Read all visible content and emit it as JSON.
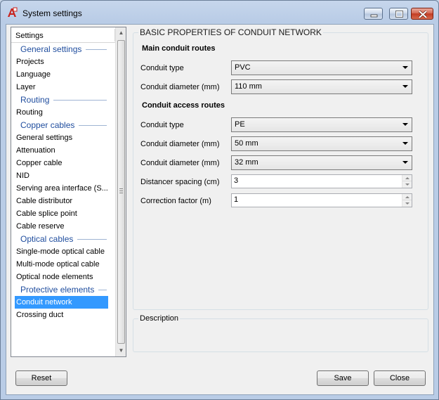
{
  "window": {
    "title": "System settings",
    "controls": [
      "minimize",
      "maximize",
      "close"
    ]
  },
  "tree": {
    "header": "Settings",
    "rows": [
      {
        "type": "section",
        "label": "General settings"
      },
      {
        "type": "item",
        "label": "Projects"
      },
      {
        "type": "item",
        "label": "Language"
      },
      {
        "type": "item",
        "label": "Layer"
      },
      {
        "type": "section",
        "label": "Routing"
      },
      {
        "type": "item",
        "label": "Routing"
      },
      {
        "type": "section",
        "label": "Copper cables"
      },
      {
        "type": "item",
        "label": "General settings"
      },
      {
        "type": "item",
        "label": "Attenuation"
      },
      {
        "type": "item",
        "label": "Copper cable"
      },
      {
        "type": "item",
        "label": "NID"
      },
      {
        "type": "item",
        "label": "Serving area interface (S..."
      },
      {
        "type": "item",
        "label": "Cable distributor"
      },
      {
        "type": "item",
        "label": "Cable splice point"
      },
      {
        "type": "item",
        "label": "Cable reserve"
      },
      {
        "type": "section",
        "label": "Optical cables"
      },
      {
        "type": "item",
        "label": "Single-mode optical cable"
      },
      {
        "type": "item",
        "label": "Multi-mode optical cable"
      },
      {
        "type": "item",
        "label": "Optical node elements"
      },
      {
        "type": "section",
        "label": "Protective elements"
      },
      {
        "type": "item",
        "label": "Conduit network",
        "selected": true
      },
      {
        "type": "item",
        "label": "Crossing duct"
      }
    ]
  },
  "panel": {
    "title": "BASIC PROPERTIES OF CONDUIT NETWORK",
    "main_routes": {
      "heading": "Main conduit routes",
      "conduit_type_label": "Conduit type",
      "conduit_type_value": "PVC",
      "conduit_diameter_label": "Conduit diameter (mm)",
      "conduit_diameter_value": "110 mm"
    },
    "access_routes": {
      "heading": "Conduit access routes",
      "conduit_type_label": "Conduit type",
      "conduit_type_value": "PE",
      "conduit_diameter_1_label": "Conduit diameter (mm)",
      "conduit_diameter_1_value": "50 mm",
      "conduit_diameter_2_label": "Conduit diameter (mm)",
      "conduit_diameter_2_value": "32 mm",
      "distancer_spacing_label": "Distancer spacing (cm)",
      "distancer_spacing_value": "3",
      "correction_factor_label": "Correction factor (m)",
      "correction_factor_value": "1"
    },
    "description_title": "Description"
  },
  "buttons": {
    "reset": "Reset",
    "save": "Save",
    "close": "Close"
  },
  "colors": {
    "section_text": "#1f4d9e",
    "selection": "#3399ff",
    "app_icon_red": "#c8201a"
  }
}
